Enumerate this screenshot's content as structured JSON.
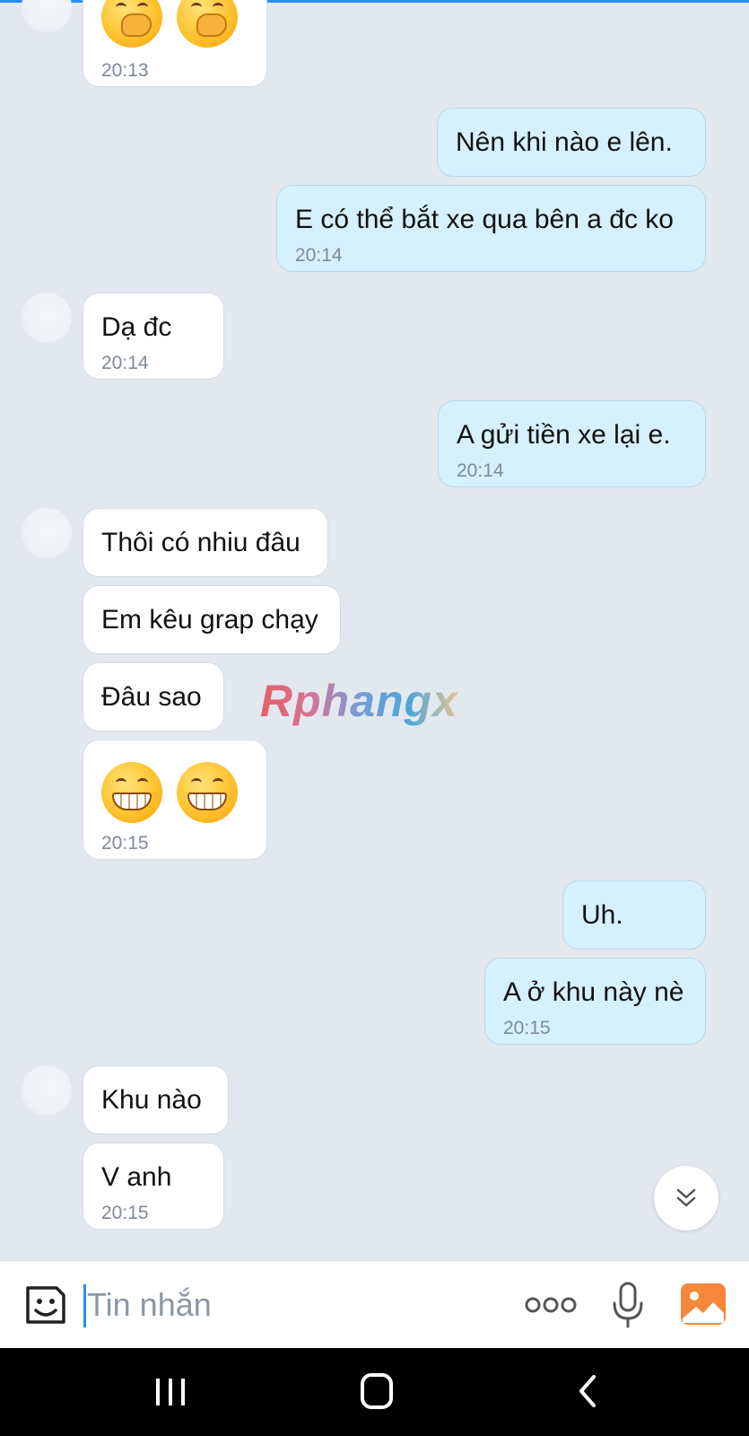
{
  "messages": [
    {
      "side": "in",
      "emoji": [
        "face-with-hand-over-mouth",
        "face-with-hand-over-mouth"
      ],
      "time": "20:13"
    },
    {
      "side": "out",
      "text": "Nên khi nào e lên."
    },
    {
      "side": "out",
      "text": "E có thể bắt xe qua bên a đc ko",
      "time": "20:14"
    },
    {
      "side": "in",
      "text": "Dạ đc",
      "time": "20:14"
    },
    {
      "side": "out",
      "text": "A gửi tiền xe lại e.",
      "time": "20:14"
    },
    {
      "side": "in",
      "text": "Thôi có nhiu đâu"
    },
    {
      "side": "in",
      "text": "Em kêu grap chạy"
    },
    {
      "side": "in",
      "text": "Đâu sao"
    },
    {
      "side": "in",
      "emoji": [
        "grinning-face",
        "grinning-face"
      ],
      "time": "20:15"
    },
    {
      "side": "out",
      "text": "Uh."
    },
    {
      "side": "out",
      "text": "A ở khu này nè",
      "time": "20:15"
    },
    {
      "side": "in",
      "text": "Khu nào"
    },
    {
      "side": "in",
      "text": "V anh",
      "time": "20:15"
    }
  ],
  "watermark": "Rphangx",
  "scroll_button": {
    "icon": "chevrons-down-icon"
  },
  "composer": {
    "placeholder": "Tin nhắn",
    "icons": [
      "emoji-sticker-icon",
      "more-dots-icon",
      "microphone-icon",
      "image-gallery-icon"
    ]
  },
  "navbar": {
    "icons": [
      "recents-icon",
      "home-icon",
      "back-icon"
    ]
  },
  "colors": {
    "incoming": "#ffffff",
    "outgoing": "#d7f0fe",
    "background": "#e3e8ef",
    "accent": "#2b8cf7",
    "gallery": "#f5873a"
  }
}
